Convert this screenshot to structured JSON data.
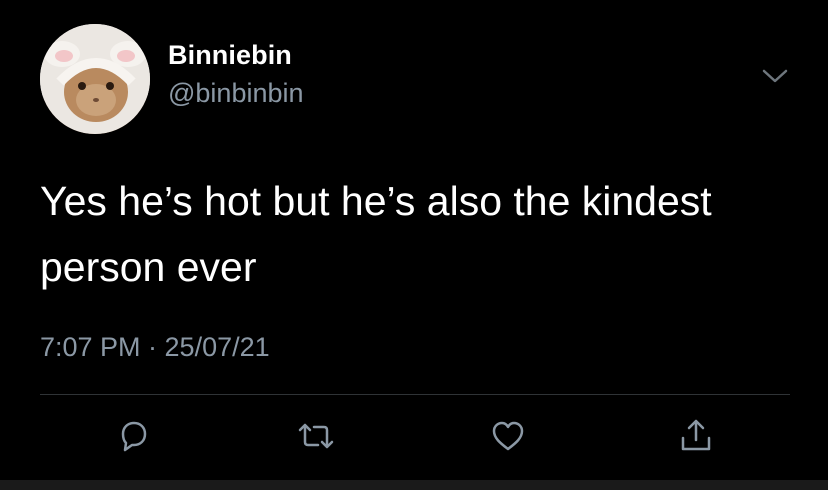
{
  "tweet": {
    "display_name": "Binniebin",
    "handle": "@binbinbin",
    "text": "Yes he’s hot but he’s also the kindest person ever",
    "timestamp": "7:07 PM · 25/07/21"
  },
  "icons": {
    "menu": "chevron-down-icon",
    "reply": "reply-icon",
    "retweet": "retweet-icon",
    "like": "heart-icon",
    "share": "share-icon"
  },
  "colors": {
    "background": "#000000",
    "text_primary": "#ffffff",
    "text_secondary": "#8b98a5",
    "divider": "#2f3336"
  }
}
